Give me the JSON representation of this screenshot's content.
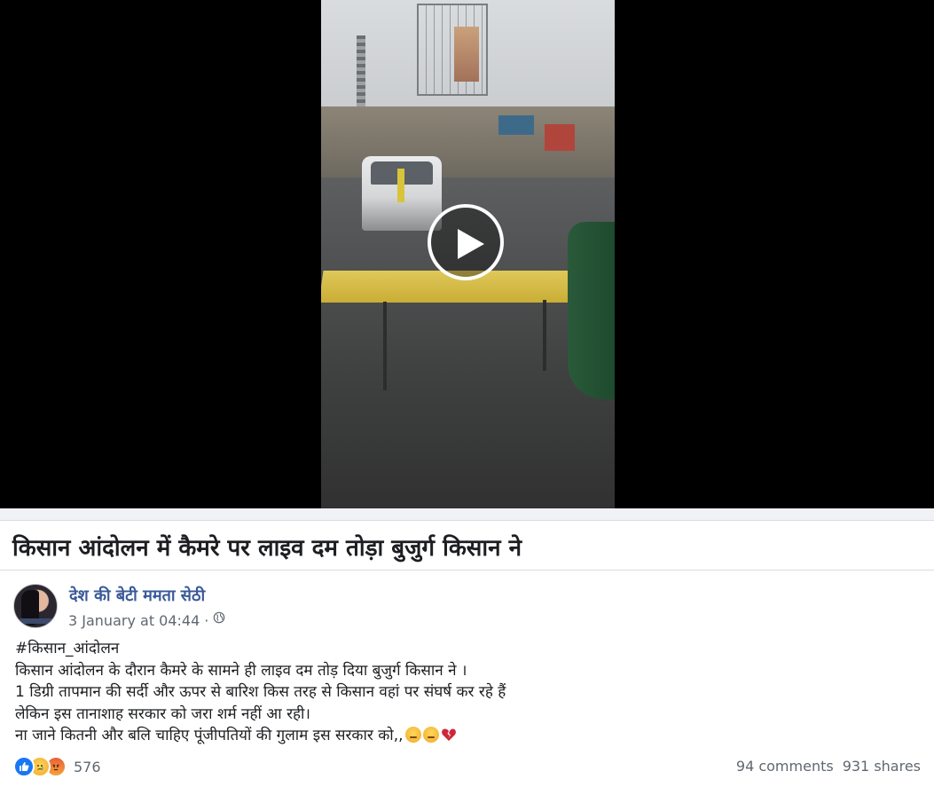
{
  "headline": "किसान आंदोलन में कैमरे पर लाइव दम तोड़ा बुजुर्ग किसान ने",
  "post": {
    "author": "देश की बेटी ममता सेठी",
    "date": "3 January at 04:44",
    "separator": "·",
    "privacy_icon": "globe-icon",
    "lines": [
      "#किसान_आंदोलन",
      "किसान आंदोलन के दौरान कैमरे के सामने ही लाइव दम तोड़ दिया बुजुर्ग किसान ने ।",
      "1 डिग्री तापमान की सर्दी और ऊपर से बारिश किस तरह से किसान वहां पर संघर्ष कर रहे हैं",
      "लेकिन इस तानाशाह सरकार को जरा शर्म नहीं आ रही।",
      "ना जाने कितनी और बलि चाहिए पूंजीपतियों की गुलाम इस सरकार को,,"
    ],
    "trailing_emojis": [
      "pensive-face-emoji",
      "pensive-face-emoji",
      "broken-heart-emoji"
    ]
  },
  "reactions": {
    "icons": [
      "like-icon",
      "sad-icon",
      "angry-icon"
    ],
    "count": "576"
  },
  "engagement": {
    "comments": "94 comments",
    "shares": "931 shares"
  },
  "video": {
    "play_icon": "play-icon"
  },
  "colors": {
    "author_link": "#385898",
    "meta_text": "#606770",
    "like_blue": "#1877f2"
  }
}
